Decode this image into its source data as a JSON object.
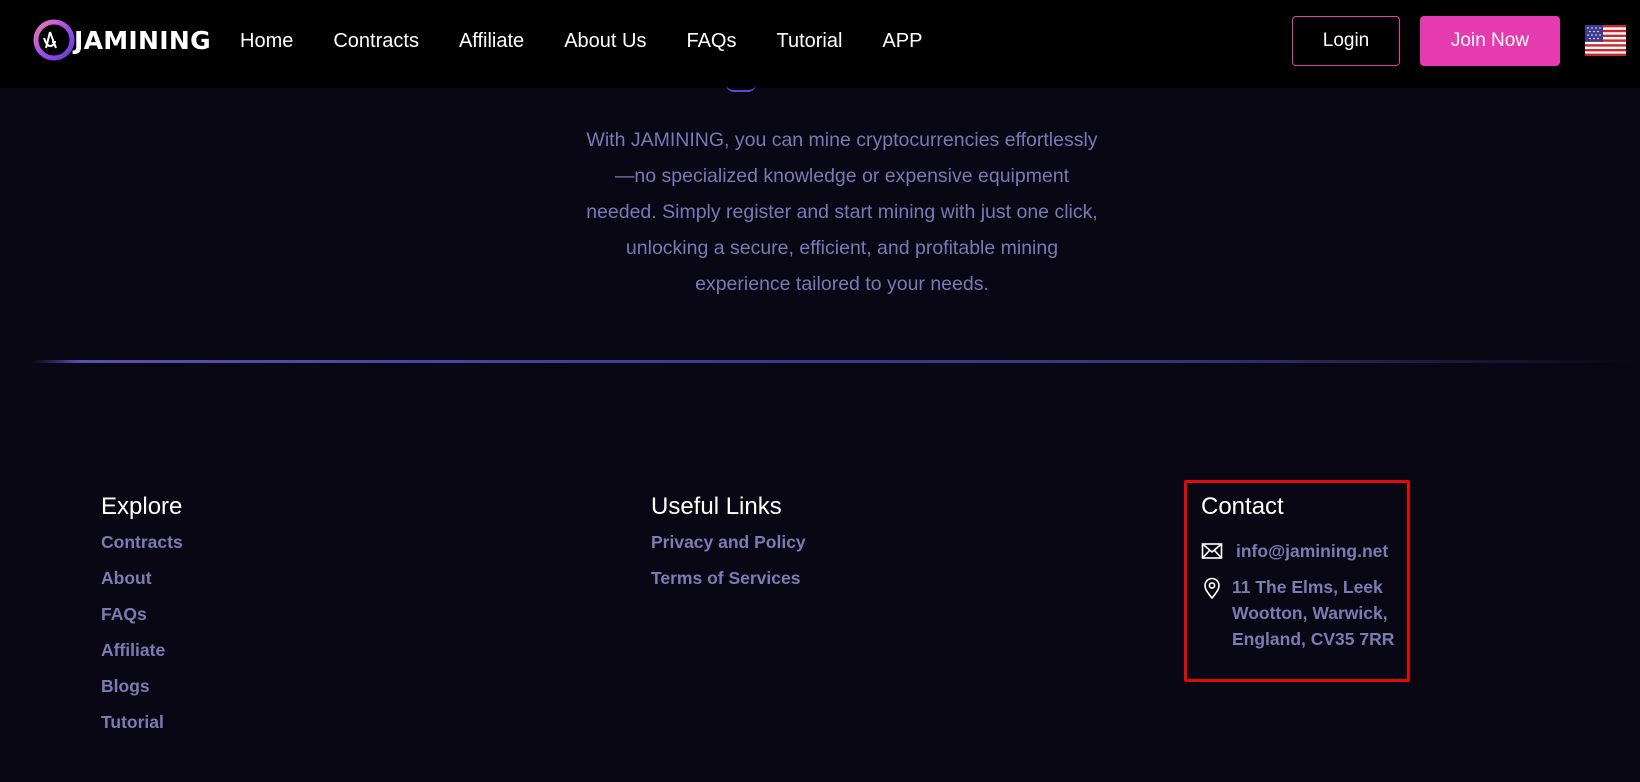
{
  "header": {
    "logo_text": "JAMINING",
    "logo_icon": "ja-logo-icon",
    "nav": [
      {
        "label": "Home"
      },
      {
        "label": "Contracts"
      },
      {
        "label": "Affiliate"
      },
      {
        "label": "About Us"
      },
      {
        "label": "FAQs"
      },
      {
        "label": "Tutorial"
      },
      {
        "label": "APP"
      }
    ],
    "login_label": "Login",
    "join_label": "Join Now",
    "language_icon": "us-flag-icon"
  },
  "intro": {
    "lines": [
      "With JAMINING, you can mine cryptocurrencies effortlessly",
      "—no specialized knowledge or expensive equipment",
      "needed. Simply register and start mining with just one click,",
      "unlocking a secure, efficient, and profitable mining",
      "experience tailored to your needs."
    ]
  },
  "footer": {
    "explore": {
      "title": "Explore",
      "links": [
        "Contracts",
        "About",
        "FAQs",
        "Affiliate",
        "Blogs",
        "Tutorial"
      ]
    },
    "useful_links": {
      "title": "Useful Links",
      "links": [
        "Privacy and Policy",
        "Terms of Services"
      ]
    },
    "contact": {
      "title": "Contact",
      "email": "info@jamining.net",
      "address_lines": [
        "11 The Elms, Leek",
        "Wootton, Warwick,",
        "England, CV35 7RR"
      ]
    }
  },
  "colors": {
    "background": "#080713",
    "header": "#000000",
    "accent_pink": "#e63bb0",
    "muted_text": "#7b78b6",
    "highlight_box": "#e00a0a"
  }
}
